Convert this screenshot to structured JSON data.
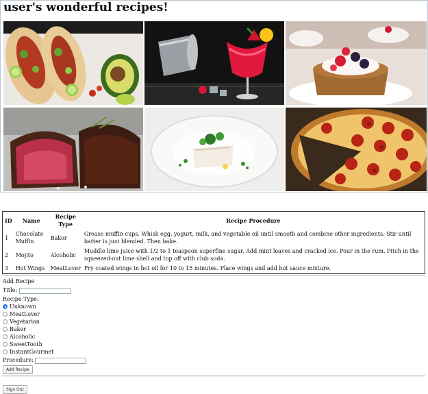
{
  "header": {
    "title": "user's wonderful recipes!"
  },
  "table": {
    "columns": [
      "ID",
      "Name",
      "Recipe Type",
      "Recipe Procedure"
    ],
    "rows": [
      {
        "id": "1",
        "name": "Chocolate Muffin",
        "type": "Baker",
        "procedure": "Grease muffin cups. Whisk egg, yogurt, milk, and vegetable oil until smooth and combine other ingredients. Stir until batter is just blended. Then bake."
      },
      {
        "id": "2",
        "name": "Mojito",
        "type": "Alcoholic",
        "procedure": "Muddle lime juice with 1/2 to 1 teaspoon superfine sugar. Add mint leaves and cracked ice. Pour in the rum. Pitch in the squeezed-out lime shell and top off with club soda."
      },
      {
        "id": "3",
        "name": "Hot Wings",
        "type": "MeatLover",
        "procedure": "Fry coated wings in hot oil for 10 to 15 minutes. Place wings and add hot sauce mixture."
      }
    ]
  },
  "form": {
    "heading": "Add Recipe",
    "title_label": "Title:",
    "title_value": "",
    "type_label": "Recipe Type:",
    "types": [
      "Unknown",
      "MeatLover",
      "Vegetarian",
      "Baker",
      "Alcoholic",
      "SweetTooth",
      "InstantGourmet"
    ],
    "selected_type": "Unknown",
    "procedure_label": "Procedure:",
    "procedure_value": "",
    "submit_label": "Add Recipe"
  },
  "signout_label": "Sign Out",
  "colors": {
    "radio_selected": "#2d7df6",
    "border": "#b9c6d6"
  },
  "gallery": [
    {
      "name": "tacos-photo"
    },
    {
      "name": "cocktail-photo"
    },
    {
      "name": "berry-tart-photo"
    },
    {
      "name": "steak-photo"
    },
    {
      "name": "fish-dish-photo"
    },
    {
      "name": "pepperoni-pizza-photo"
    }
  ]
}
